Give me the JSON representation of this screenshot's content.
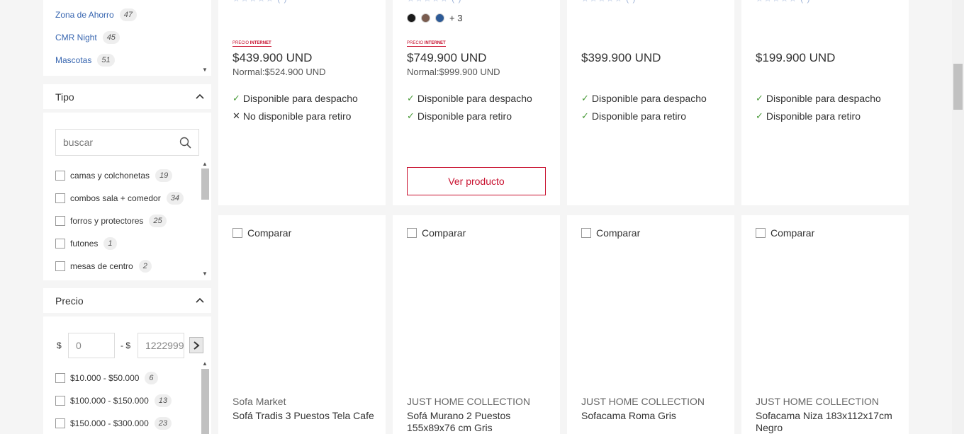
{
  "sidebar": {
    "links": [
      {
        "label": "Zona de Ahorro",
        "count": "47"
      },
      {
        "label": "CMR Night",
        "count": "45"
      },
      {
        "label": "Mascotas",
        "count": "51"
      }
    ],
    "tipo": {
      "title": "Tipo",
      "search_placeholder": "buscar",
      "options": [
        {
          "label": "camas y colchonetas",
          "count": "19"
        },
        {
          "label": "combos sala + comedor",
          "count": "34"
        },
        {
          "label": "forros y protectores",
          "count": "25"
        },
        {
          "label": "futones",
          "count": "1"
        },
        {
          "label": "mesas de centro",
          "count": "2"
        }
      ]
    },
    "precio": {
      "title": "Precio",
      "currency": "$",
      "separator": "- $",
      "min_value": "0",
      "max_value": "1222999",
      "ranges": [
        {
          "label": "$10.000 - $50.000",
          "count": "6"
        },
        {
          "label": "$100.000 - $150.000",
          "count": "13"
        },
        {
          "label": "$150.000 - $300.000",
          "count": "23"
        }
      ]
    }
  },
  "products_top": [
    {
      "badge_a": "PRECIO",
      "badge_b": "INTERNET",
      "price": "$439.900 UND",
      "normal": "Normal:$524.900 UND",
      "despacho": "Disponible para despacho",
      "retiro": "No disponible para retiro",
      "retiro_ok": false
    },
    {
      "badge_a": "PRECIO",
      "badge_b": "INTERNET",
      "price": "$749.900 UND",
      "normal": "Normal:$999.900 UND",
      "despacho": "Disponible para despacho",
      "retiro": "Disponible para retiro",
      "retiro_ok": true,
      "swatches": [
        "#1a1a1a",
        "#7a5c4f",
        "#2d5a96"
      ],
      "more_colors": "+ 3",
      "button": "Ver producto"
    },
    {
      "price": "$399.900 UND",
      "despacho": "Disponible para despacho",
      "retiro": "Disponible para retiro",
      "retiro_ok": true
    },
    {
      "price": "$199.900 UND",
      "despacho": "Disponible para despacho",
      "retiro": "Disponible para retiro",
      "retiro_ok": true
    }
  ],
  "products_bottom": [
    {
      "compare": "Comparar",
      "brand": "Sofa Market",
      "name": "Sofá Tradis 3 Puestos Tela Cafe"
    },
    {
      "compare": "Comparar",
      "brand": "JUST HOME COLLECTION",
      "name": "Sofá Murano 2 Puestos 155x89x76 cm Gris"
    },
    {
      "compare": "Comparar",
      "brand": "JUST HOME COLLECTION",
      "name": "Sofacama Roma Gris"
    },
    {
      "compare": "Comparar",
      "brand": "JUST HOME COLLECTION",
      "name": "Sofacama Niza 183x112x17cm Negro"
    }
  ],
  "icons": {
    "check": "✓",
    "cross": "✕",
    "chevron_up": "chevron-up-icon",
    "search": "search-icon",
    "next": "chevron-right-icon"
  },
  "colors": {
    "accent": "#c8102e",
    "link": "#3866b0",
    "available": "#4a9b3a"
  }
}
